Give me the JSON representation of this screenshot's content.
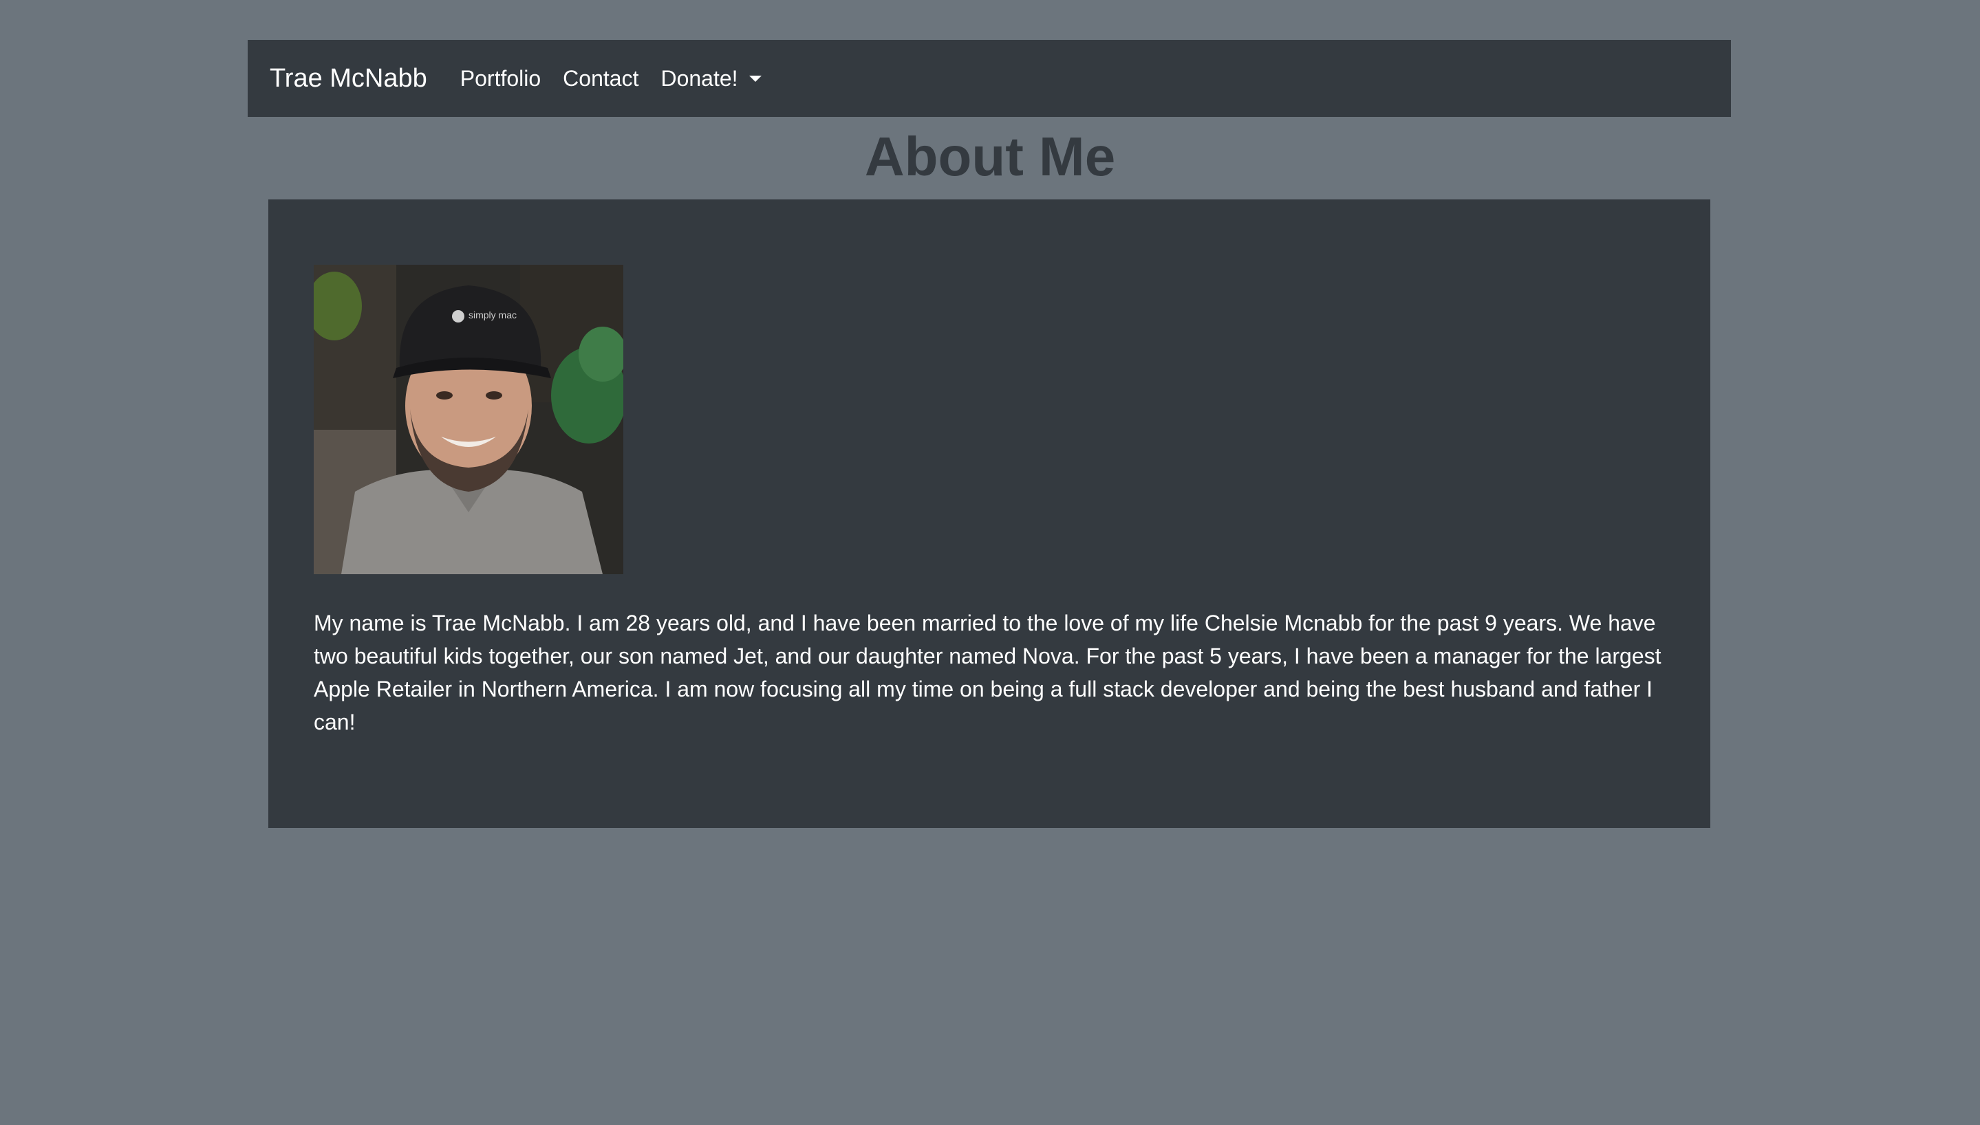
{
  "navbar": {
    "brand": "Trae McNabb",
    "links": [
      {
        "label": "Portfolio"
      },
      {
        "label": "Contact"
      }
    ],
    "dropdown": {
      "label": "Donate!"
    }
  },
  "main": {
    "title": "About Me",
    "photo": {
      "cap_text": "simply mac"
    },
    "bio": "My name is Trae McNabb. I am 28 years old, and I have been married to the love of my life Chelsie Mcnabb for the past 9 years. We have two beautiful kids together, our son named Jet, and our daughter named Nova. For the past 5 years, I have been a manager for the largest Apple Retailer in Northern America. I am now focusing all my time on being a full stack developer and being the best husband and father I can!"
  },
  "colors": {
    "page_background": "#6c757d",
    "navbar_background": "#343a40",
    "card_background": "#343a40",
    "title_color": "#343a40",
    "text_color": "#ffffff"
  }
}
